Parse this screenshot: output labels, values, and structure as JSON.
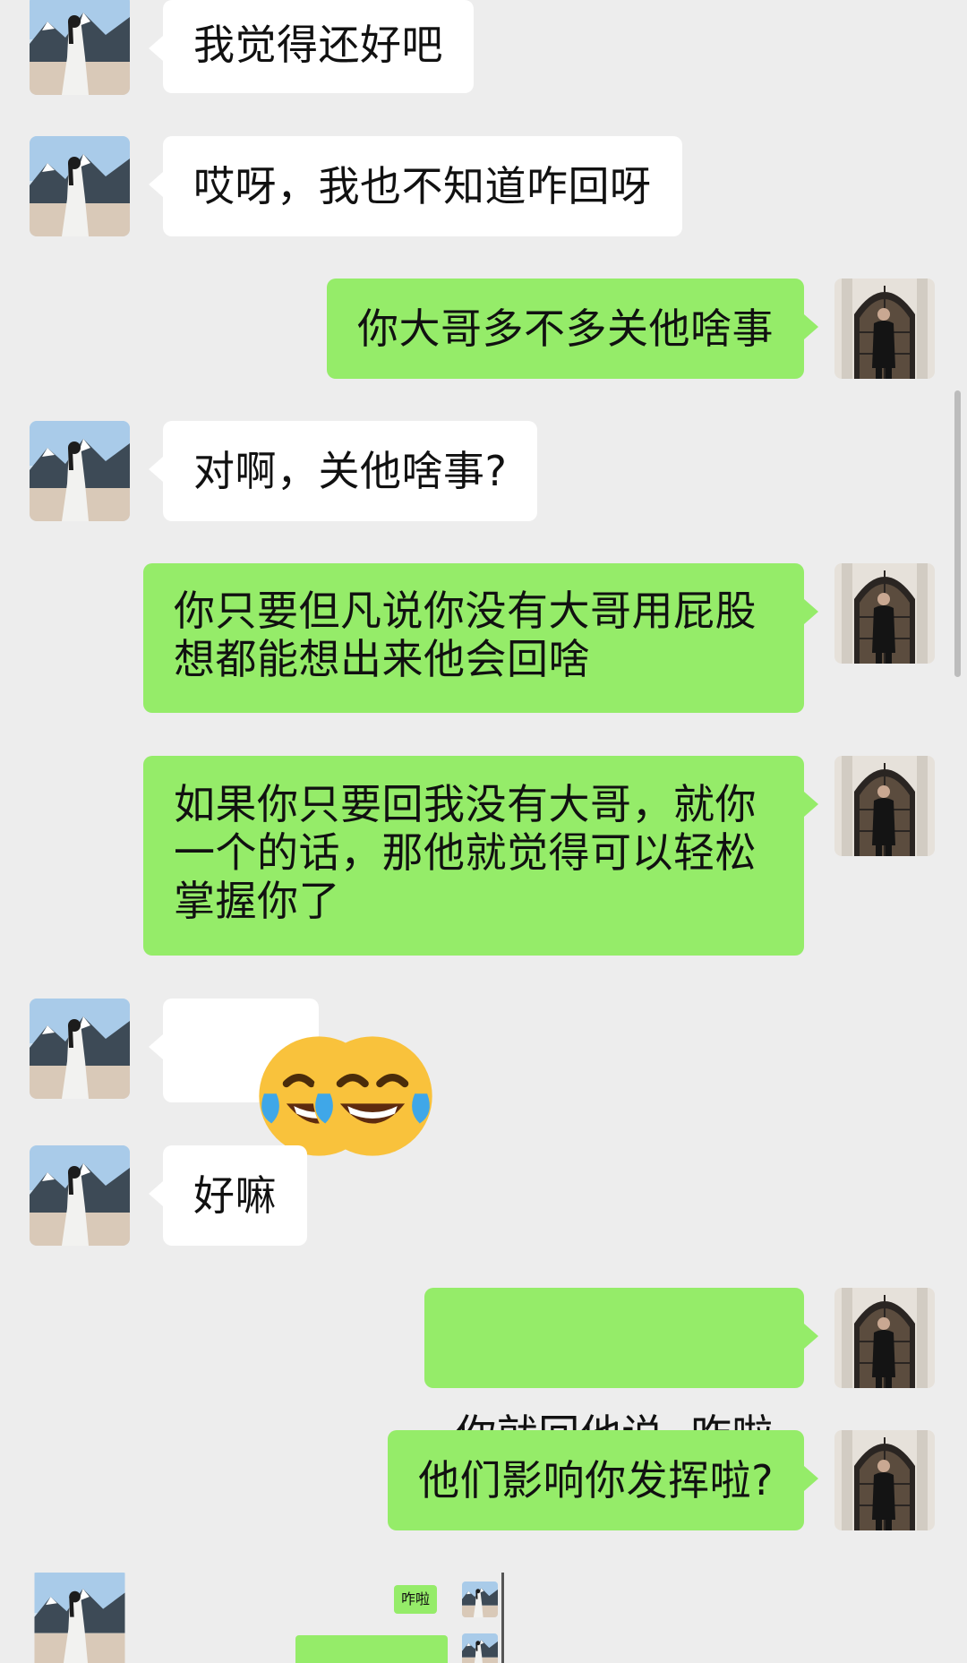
{
  "chat": {
    "messages": [
      {
        "side": "left",
        "text": "我觉得还好吧"
      },
      {
        "side": "left",
        "text": "哎呀，我也不知道咋回呀"
      },
      {
        "side": "right",
        "text": "你大哥多不多关他啥事"
      },
      {
        "side": "left",
        "text": "对啊，关他啥事?"
      },
      {
        "side": "right",
        "lines": [
          "你只要但凡说你没有大哥用屁股",
          "想都能想出来他会回啥"
        ]
      },
      {
        "side": "right",
        "lines": [
          "如果你只要回我没有大哥，就你",
          "一个的话，那他就觉得可以轻松",
          "掌握你了"
        ]
      },
      {
        "side": "left",
        "emoji": [
          "tears-of-joy-emoji",
          "tears-of-joy-emoji"
        ]
      },
      {
        "side": "left",
        "text": "好嘛"
      },
      {
        "side": "right",
        "text": "你就回他说  咋啦"
      },
      {
        "side": "right",
        "text": "他们影响你发挥啦?"
      }
    ],
    "embedded_screenshot": {
      "bubble_text": "咋啦"
    }
  },
  "colors": {
    "background": "#ededed",
    "incoming_bubble": "#ffffff",
    "outgoing_bubble": "#95ec69"
  },
  "icons": {
    "left_avatar": "woman-landscape-avatar",
    "right_avatar": "man-gothic-window-avatar"
  }
}
